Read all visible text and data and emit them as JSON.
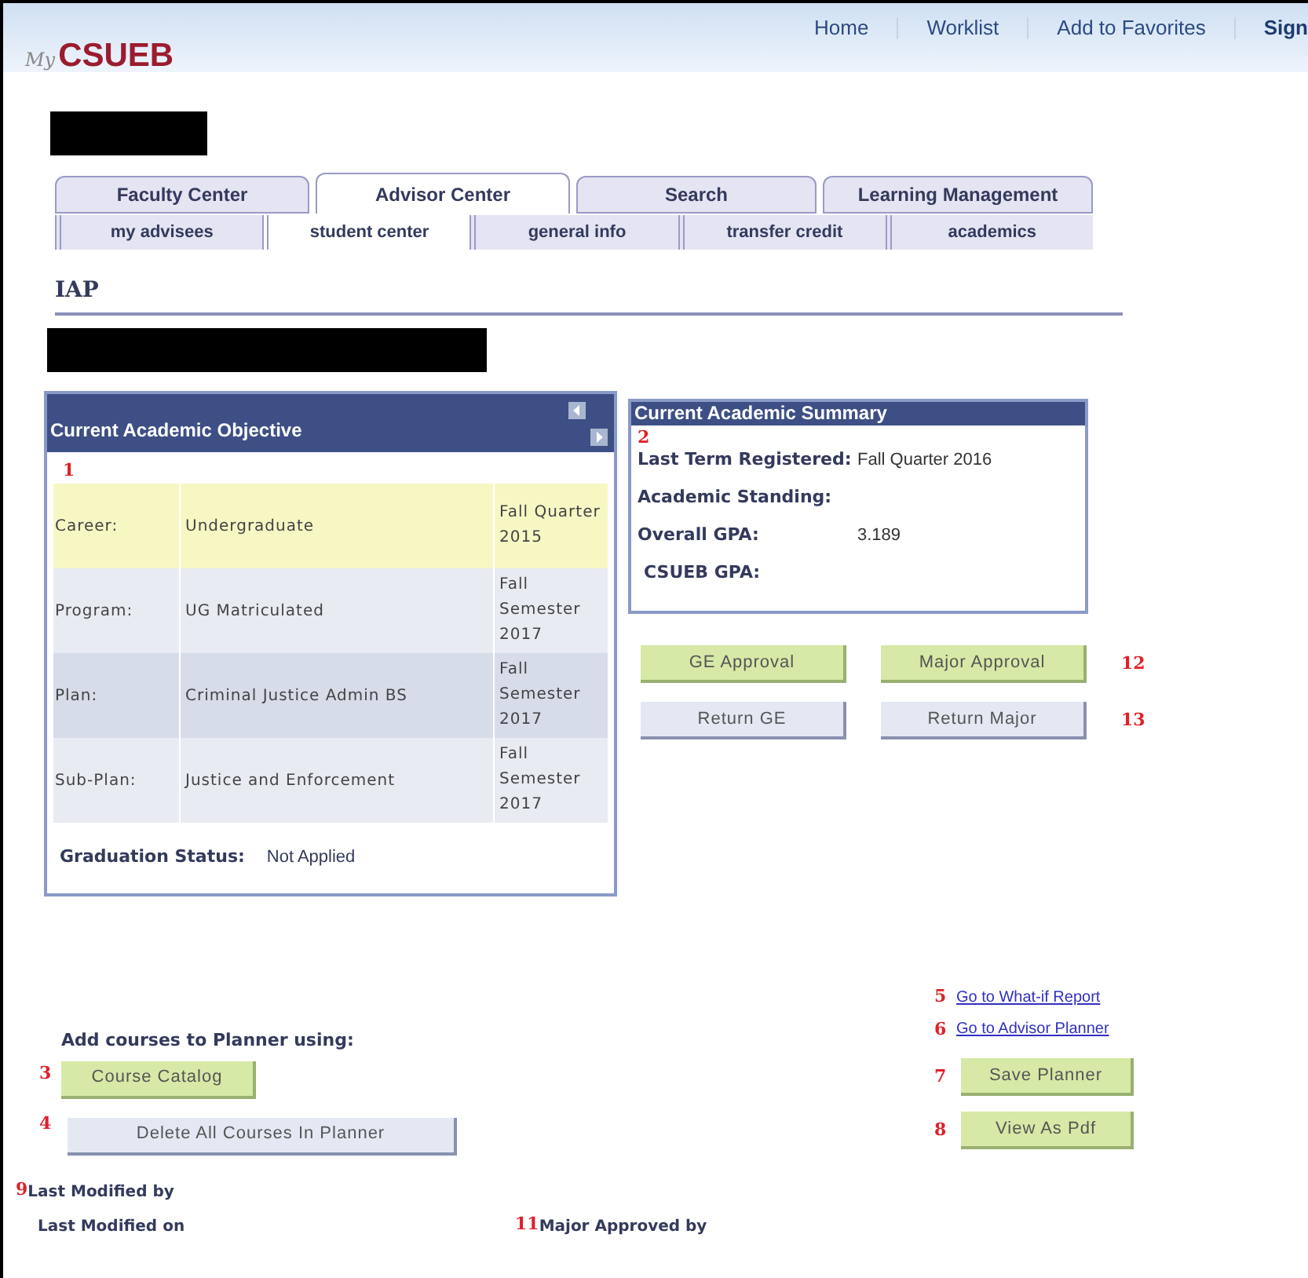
{
  "header": {
    "logo_prefix": "My",
    "logo_name": "CSUEB",
    "nav": [
      "Home",
      "Worklist",
      "Add to Favorites",
      "Sign"
    ]
  },
  "tabs": [
    {
      "label": "Faculty Center",
      "selected": false
    },
    {
      "label": "Advisor Center",
      "selected": true
    },
    {
      "label": "Search",
      "selected": false
    },
    {
      "label": "Learning Management",
      "selected": false
    }
  ],
  "subtabs": [
    {
      "label": "my advisees",
      "selected": false
    },
    {
      "label": "student center",
      "selected": true
    },
    {
      "label": "general info",
      "selected": false
    },
    {
      "label": "transfer credit",
      "selected": false
    },
    {
      "label": "academics",
      "selected": false
    }
  ],
  "page_title": "IAP",
  "objective": {
    "title": "Current Academic Objective",
    "annotation": "1",
    "rows": [
      {
        "label": "Career:",
        "value": "Undergraduate",
        "term": "Fall Quarter 2015",
        "highlighted": true
      },
      {
        "label": "Program:",
        "value": "UG Matriculated",
        "term": "Fall Semester 2017",
        "highlighted": false
      },
      {
        "label": "Plan:",
        "value": "Criminal Justice Admin BS",
        "term": "Fall Semester 2017",
        "highlighted": false
      },
      {
        "label": "Sub-Plan:",
        "value": "Justice and Enforcement",
        "term": "Fall Semester 2017",
        "highlighted": false
      }
    ],
    "graduation_label": "Graduation Status:",
    "graduation_value": "Not Applied"
  },
  "summary": {
    "title": "Current Academic Summary",
    "annotation": "2",
    "fields": [
      {
        "label": "Last Term Registered:",
        "value": "Fall Quarter 2016"
      },
      {
        "label": "Academic Standing:"
      },
      {
        "label": "Overall GPA:",
        "value": "3.189"
      },
      {
        "label": "CSUEB GPA:"
      }
    ]
  },
  "approval_rows": [
    {
      "annotation": "12",
      "buttons": [
        {
          "label": "GE Approval",
          "kind": "approve"
        },
        {
          "label": "Major Approval",
          "kind": "approve"
        }
      ]
    },
    {
      "annotation": "13",
      "buttons": [
        {
          "label": "Return GE",
          "kind": "return"
        },
        {
          "label": "Return Major",
          "kind": "return"
        }
      ]
    }
  ],
  "planner": {
    "heading": "Add courses to Planner using:",
    "buttons": [
      {
        "annotation": "3",
        "label": "Course Catalog",
        "kind": "approve"
      },
      {
        "annotation": "4",
        "label": "Delete All Courses In Planner",
        "kind": "return"
      }
    ]
  },
  "links": [
    {
      "annotation": "5",
      "label": "Go to What-if Report"
    },
    {
      "annotation": "6",
      "label": "Go to Advisor Planner"
    }
  ],
  "actions": [
    {
      "annotation": "7",
      "label": "Save Planner",
      "kind": "approve"
    },
    {
      "annotation": "8",
      "label": "View As Pdf",
      "kind": "approve"
    }
  ],
  "footer": [
    {
      "annotation": "9",
      "label": "Last Modified by"
    },
    {
      "label": "Last Modified on"
    },
    {
      "annotation": "11",
      "label": "Major Approved by"
    }
  ]
}
